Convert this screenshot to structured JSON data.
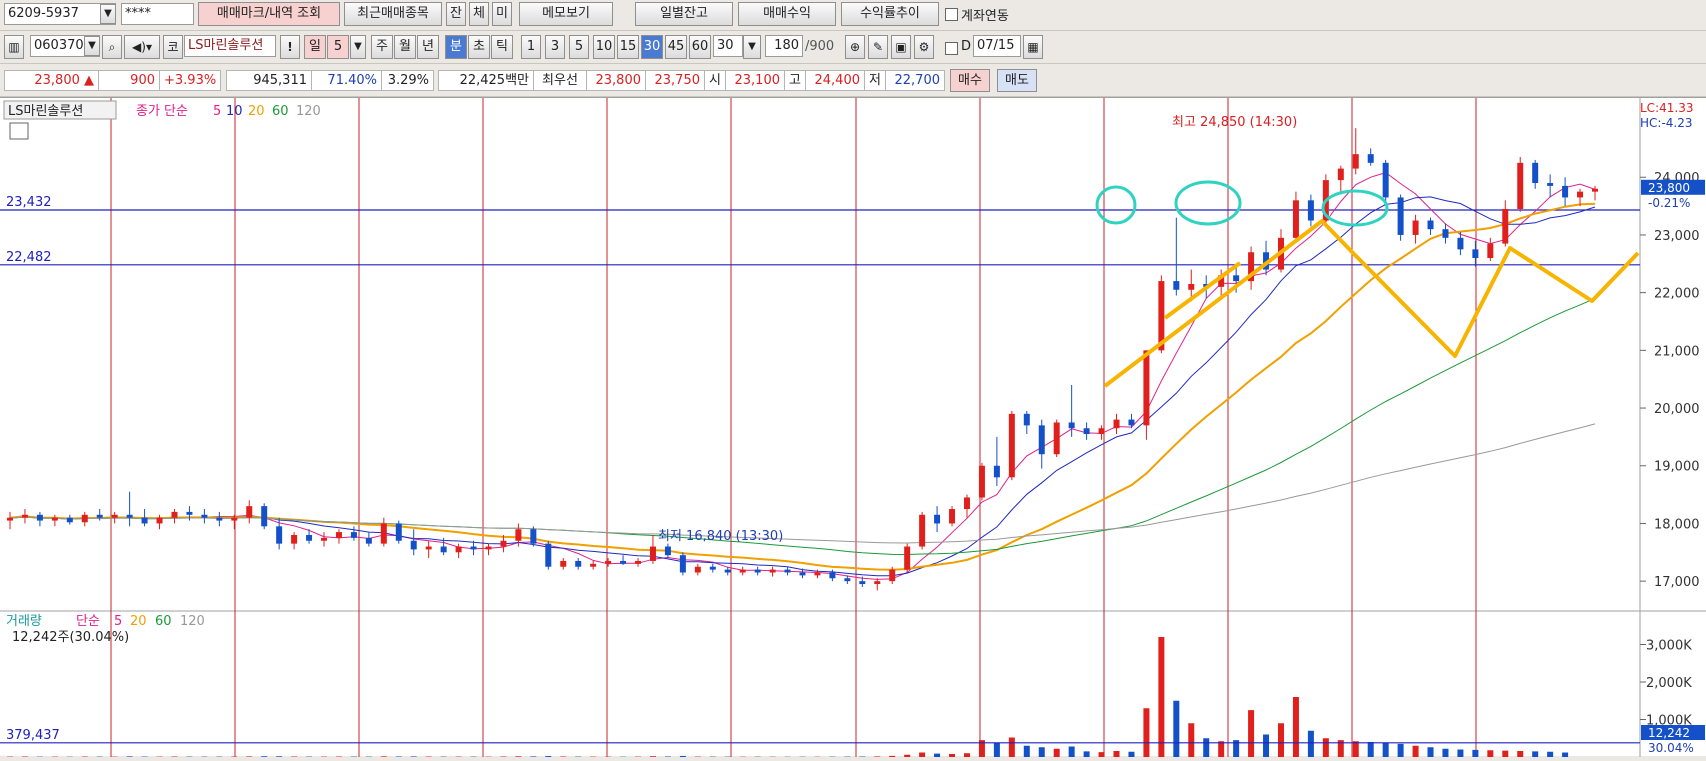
{
  "toolbar1": {
    "account": "6209-5937",
    "password": "****",
    "btn_trade_mark": "매매마크/내역 조회",
    "btn_recent": "최근매매종목",
    "btn_jan": "잔",
    "btn_che": "체",
    "btn_mi": "미",
    "btn_memo": "메모보기",
    "btn_daily": "일별잔고",
    "btn_profit": "매매수익",
    "btn_return": "수익률추이",
    "chk_link": "계좌연동"
  },
  "toolbar2": {
    "code": "060370",
    "market": "코",
    "name": "LS마린솔루션",
    "excl": "!",
    "period_label": "일",
    "period_value": "5",
    "week": "주",
    "month": "월",
    "year": "년",
    "minute": "분",
    "second": "초",
    "tick": "틱",
    "intervals": [
      "1",
      "3",
      "5",
      "10",
      "15",
      "30",
      "45",
      "60"
    ],
    "interval_select": "30",
    "count": "180",
    "count_total": "/900",
    "d_label": "D",
    "date": "07/15"
  },
  "quote": {
    "price": "23,800 ▲",
    "change": "900",
    "change_pct": "+3.93%",
    "volume": "945,311",
    "vol_pct": "71.40%",
    "turnover": "3.29%",
    "amount": "22,425백만",
    "best_label": "최우선",
    "ask": "23,800",
    "bid": "23,750",
    "open_label": "시",
    "open": "23,100",
    "high_label": "고",
    "high": "24,400",
    "low_label": "저",
    "low": "22,700",
    "buy": "매수",
    "sell": "매도"
  },
  "price_pane": {
    "stock_label": "LS마린솔루션",
    "ma_label": "종가 단순",
    "ma_periods": [
      "5",
      "10",
      "20",
      "60",
      "120"
    ],
    "lc": "LC:41.33",
    "hc": "HC:-4.23",
    "hline_top": "23,432",
    "hline_bottom": "22,482",
    "high_note": "최고 24,850 (14:30)",
    "low_note": "최저 16,840 (13:30)",
    "last_price_tag": "23,800",
    "last_pct_tag": "-0.21%",
    "y_ticks": [
      "24,000",
      "23,000",
      "22,000",
      "21,000",
      "20,000",
      "19,000",
      "18,000",
      "17,000"
    ]
  },
  "volume_pane": {
    "label": "거래량",
    "ma_label": "단순",
    "ma_periods": [
      "5",
      "20",
      "60",
      "120"
    ],
    "last_volume": "12,242주(30.04%)",
    "hline": "379,437",
    "tag": "12,242",
    "tag_pct": "30.04%",
    "y_ticks": [
      "3,000K",
      "2,000K",
      "1,000K"
    ]
  },
  "colors": {
    "up": "#e0201c",
    "down": "#1450c8",
    "ma5": "#e0208c",
    "ma10": "#1f2ac0",
    "ma20": "#f0a000",
    "ma60": "#1a9a3a",
    "ma120": "#999999",
    "vline": "#c8202a",
    "hline": "#2020c0",
    "annotation": "#f7b400",
    "circle": "#2fd3c0"
  },
  "chart_data": {
    "type": "candlestick",
    "interval": "30분",
    "ylim": [
      16500,
      25200
    ],
    "candles": [
      [
        18050,
        18200,
        17900,
        18100
      ],
      [
        18100,
        18250,
        18000,
        18150
      ],
      [
        18150,
        18200,
        17950,
        18050
      ],
      [
        18050,
        18150,
        17950,
        18100
      ],
      [
        18100,
        18150,
        17980,
        18020
      ],
      [
        18020,
        18200,
        17950,
        18150
      ],
      [
        18150,
        18250,
        18050,
        18100
      ],
      [
        18100,
        18200,
        18000,
        18150
      ],
      [
        18150,
        18550,
        17950,
        18100
      ],
      [
        18100,
        18250,
        17950,
        18000
      ],
      [
        18000,
        18150,
        17900,
        18100
      ],
      [
        18100,
        18250,
        18000,
        18200
      ],
      [
        18200,
        18300,
        18050,
        18150
      ],
      [
        18150,
        18250,
        18000,
        18100
      ],
      [
        18100,
        18200,
        17950,
        18050
      ],
      [
        18050,
        18150,
        17900,
        18100
      ],
      [
        18100,
        18400,
        18000,
        18300
      ],
      [
        18300,
        18350,
        17900,
        17950
      ],
      [
        17950,
        18100,
        17550,
        17650
      ],
      [
        17650,
        17850,
        17550,
        17800
      ],
      [
        17800,
        17900,
        17650,
        17700
      ],
      [
        17700,
        17850,
        17600,
        17750
      ],
      [
        17750,
        17900,
        17650,
        17850
      ],
      [
        17850,
        17950,
        17700,
        17750
      ],
      [
        17750,
        17850,
        17600,
        17650
      ],
      [
        17650,
        18100,
        17600,
        18000
      ],
      [
        18000,
        18050,
        17650,
        17700
      ],
      [
        17700,
        17900,
        17450,
        17550
      ],
      [
        17550,
        17700,
        17400,
        17600
      ],
      [
        17600,
        17750,
        17450,
        17500
      ],
      [
        17500,
        17650,
        17400,
        17600
      ],
      [
        17600,
        17700,
        17450,
        17550
      ],
      [
        17550,
        17650,
        17450,
        17600
      ],
      [
        17600,
        17800,
        17500,
        17700
      ],
      [
        17700,
        18000,
        17600,
        17900
      ],
      [
        17900,
        17950,
        17600,
        17650
      ],
      [
        17650,
        17700,
        17200,
        17250
      ],
      [
        17250,
        17400,
        17200,
        17350
      ],
      [
        17350,
        17400,
        17200,
        17250
      ],
      [
        17250,
        17350,
        17200,
        17300
      ],
      [
        17300,
        17400,
        17250,
        17350
      ],
      [
        17350,
        17450,
        17280,
        17300
      ],
      [
        17300,
        17400,
        17250,
        17350
      ],
      [
        17350,
        17800,
        17300,
        17600
      ],
      [
        17600,
        17650,
        17400,
        17450
      ],
      [
        17450,
        17500,
        17100,
        17150
      ],
      [
        17150,
        17300,
        17100,
        17250
      ],
      [
        17250,
        17300,
        17150,
        17200
      ],
      [
        17200,
        17250,
        17100,
        17150
      ],
      [
        17150,
        17250,
        17100,
        17200
      ],
      [
        17200,
        17250,
        17100,
        17150
      ],
      [
        17150,
        17250,
        17080,
        17200
      ],
      [
        17200,
        17250,
        17100,
        17150
      ],
      [
        17150,
        17220,
        17050,
        17100
      ],
      [
        17100,
        17200,
        17050,
        17150
      ],
      [
        17150,
        17200,
        17000,
        17050
      ],
      [
        17050,
        17100,
        16950,
        17000
      ],
      [
        17000,
        17080,
        16900,
        16950
      ],
      [
        16950,
        17050,
        16840,
        17000
      ],
      [
        17000,
        17250,
        16950,
        17200
      ],
      [
        17200,
        17650,
        17150,
        17600
      ],
      [
        17600,
        18200,
        17550,
        18150
      ],
      [
        18150,
        18300,
        17850,
        18000
      ],
      [
        18000,
        18300,
        17950,
        18250
      ],
      [
        18250,
        18500,
        18100,
        18450
      ],
      [
        18450,
        19050,
        18400,
        19000
      ],
      [
        19000,
        19500,
        18650,
        18800
      ],
      [
        18800,
        19950,
        18750,
        19900
      ],
      [
        19900,
        19950,
        19550,
        19700
      ],
      [
        19700,
        19800,
        18950,
        19200
      ],
      [
        19200,
        19800,
        19150,
        19750
      ],
      [
        19750,
        20400,
        19500,
        19650
      ],
      [
        19650,
        19750,
        19450,
        19550
      ],
      [
        19550,
        19700,
        19450,
        19650
      ],
      [
        19650,
        19900,
        19550,
        19800
      ],
      [
        19800,
        19900,
        19650,
        19700
      ],
      [
        19700,
        20250,
        19450,
        21000
      ],
      [
        21000,
        22300,
        20950,
        22200
      ],
      [
        22200,
        23300,
        21950,
        22050
      ],
      [
        22050,
        22400,
        21850,
        22150
      ],
      [
        22150,
        22300,
        21900,
        22100
      ],
      [
        22100,
        22400,
        21950,
        22300
      ],
      [
        22300,
        22450,
        22000,
        22200
      ],
      [
        22200,
        22800,
        22050,
        22700
      ],
      [
        22700,
        22900,
        22300,
        22400
      ],
      [
        22400,
        23100,
        22350,
        22950
      ],
      [
        22950,
        23750,
        22900,
        23600
      ],
      [
        23600,
        23700,
        23150,
        23250
      ],
      [
        23250,
        24050,
        23200,
        23950
      ],
      [
        23950,
        24200,
        23700,
        24150
      ],
      [
        24150,
        24850,
        24050,
        24400
      ],
      [
        24400,
        24500,
        24200,
        24250
      ],
      [
        24250,
        24300,
        23550,
        23650
      ],
      [
        23650,
        23700,
        22900,
        23000
      ],
      [
        23000,
        23350,
        22850,
        23250
      ],
      [
        23250,
        23300,
        23000,
        23100
      ],
      [
        23100,
        23200,
        22850,
        22950
      ],
      [
        22950,
        23050,
        22650,
        22750
      ],
      [
        22750,
        22900,
        22450,
        22600
      ],
      [
        22600,
        22950,
        22550,
        22850
      ],
      [
        22850,
        23600,
        22800,
        23450
      ],
      [
        23450,
        24350,
        23400,
        24250
      ],
      [
        24250,
        24300,
        23800,
        23900
      ],
      [
        23900,
        24050,
        23650,
        23850
      ],
      [
        23850,
        24000,
        23500,
        23650
      ],
      [
        23650,
        23800,
        23500,
        23750
      ],
      [
        23750,
        23850,
        23600,
        23800
      ]
    ],
    "volumes_k": [
      10,
      12,
      8,
      9,
      7,
      11,
      9,
      8,
      15,
      10,
      9,
      12,
      10,
      8,
      9,
      11,
      14,
      20,
      18,
      12,
      10,
      9,
      11,
      10,
      9,
      16,
      12,
      14,
      11,
      9,
      10,
      9,
      8,
      12,
      18,
      14,
      25,
      12,
      10,
      9,
      8,
      7,
      9,
      20,
      12,
      28,
      10,
      9,
      8,
      7,
      8,
      7,
      6,
      7,
      6,
      8,
      9,
      11,
      14,
      30,
      60,
      120,
      90,
      80,
      100,
      450,
      380,
      520,
      300,
      260,
      220,
      280,
      150,
      130,
      160,
      140,
      1300,
      3200,
      1500,
      900,
      500,
      420,
      450,
      1250,
      600,
      900,
      1600,
      700,
      500,
      450,
      420,
      400,
      380,
      350,
      300,
      260,
      220,
      200,
      190,
      180,
      170,
      160,
      150,
      140,
      120
    ]
  }
}
